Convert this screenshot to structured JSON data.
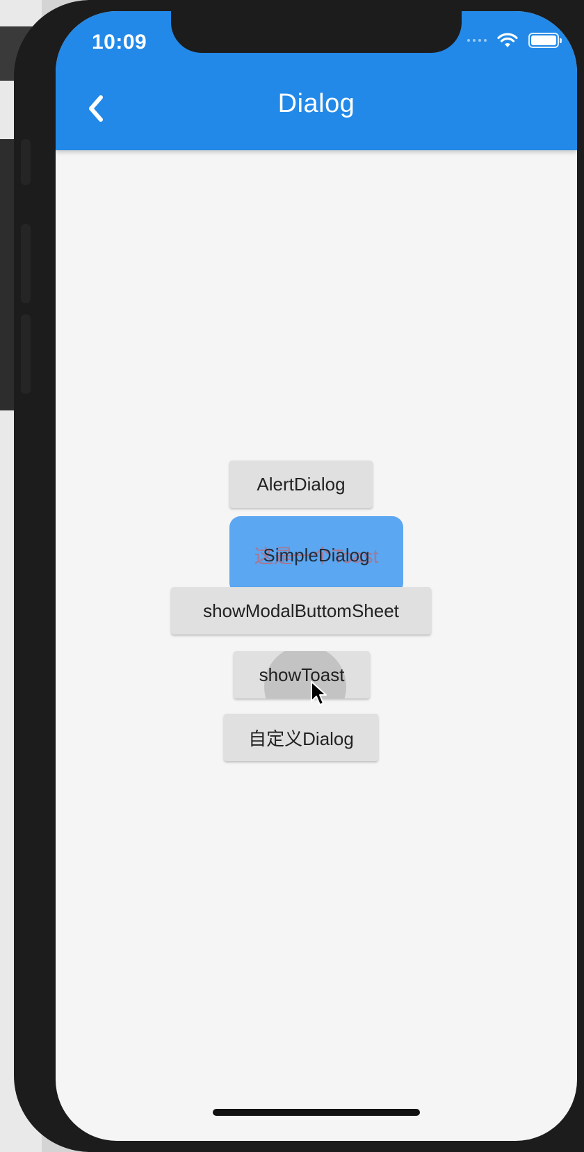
{
  "status_bar": {
    "time": "10:09",
    "wifi_icon": "wifi-icon",
    "battery_icon": "battery-icon"
  },
  "app_bar": {
    "back_icon": "chevron-left-icon",
    "title": "Dialog",
    "color": "#2289e8"
  },
  "buttons": {
    "alert_dialog": "AlertDialog",
    "simple_dialog": "SimpleDialog",
    "show_modal_bottom_sheet": "showModalButtomSheet",
    "show_toast": "showToast",
    "custom_dialog": "自定义Dialog"
  },
  "toast": {
    "message": "这是一个Toast",
    "background_color": "#3091f0",
    "text_color": "#e65046"
  },
  "pointer": {
    "icon": "mouse-pointer-icon"
  }
}
